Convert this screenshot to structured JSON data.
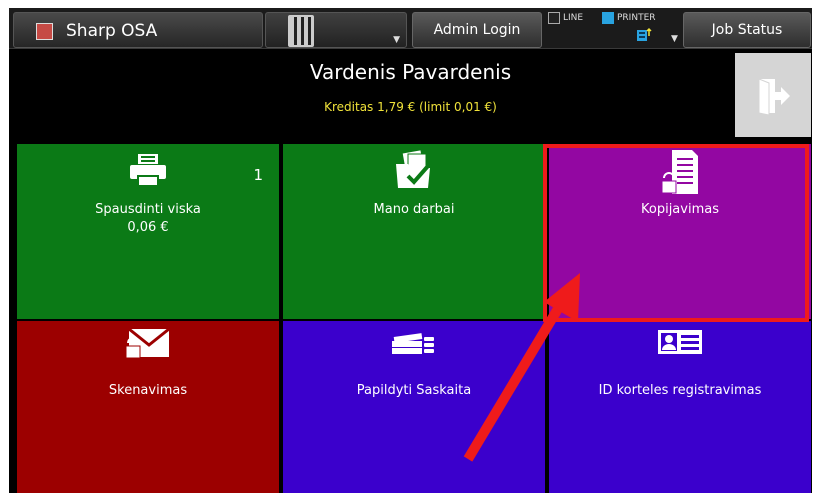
{
  "header": {
    "app_title": "Sharp OSA",
    "admin_label": "Admin Login",
    "mode_line": "LINE",
    "mode_printer": "PRINTER",
    "job_status_label": "Job Status"
  },
  "user": {
    "name": "Vardenis Pavardenis",
    "credit": "Kreditas 1,79 € (limit 0,01 €)"
  },
  "tiles": [
    {
      "label": "Spausdinti viska",
      "sublabel": "0,06 €",
      "badge": "1",
      "icon": "printer-icon"
    },
    {
      "label": "Mano darbai",
      "icon": "folder-check-icon"
    },
    {
      "label": "Kopijavimas",
      "icon": "locked-document-icon"
    },
    {
      "label": "Skenavimas",
      "icon": "locked-envelope-icon"
    },
    {
      "label": "Papildyti Saskaita",
      "icon": "money-stack-icon"
    },
    {
      "label": "ID korteles registravimas",
      "icon": "id-card-icon"
    }
  ],
  "colors": {
    "green": "#0b7a16",
    "purple": "#9307a2",
    "red": "#9c0000",
    "blue": "#3b00cc",
    "highlight": "#ef1b1b",
    "credit": "#f0e23a"
  }
}
